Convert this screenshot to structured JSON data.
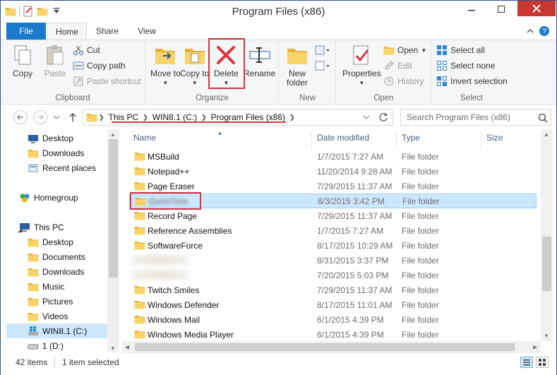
{
  "window": {
    "title": "Program Files (x86)"
  },
  "ribbon_tabs": {
    "file": "File",
    "home": "Home",
    "share": "Share",
    "view": "View"
  },
  "ribbon": {
    "clipboard": {
      "label": "Clipboard",
      "copy": "Copy",
      "paste": "Paste",
      "cut": "Cut",
      "copy_path": "Copy path",
      "paste_shortcut": "Paste shortcut"
    },
    "organize": {
      "label": "Organize",
      "move_to": "Move to",
      "copy_to": "Copy to",
      "delete": "Delete",
      "rename": "Rename"
    },
    "new": {
      "label": "New",
      "new_folder": "New folder"
    },
    "open": {
      "label": "Open",
      "properties": "Properties",
      "open": "Open",
      "edit": "Edit",
      "history": "History"
    },
    "select": {
      "label": "Select",
      "select_all": "Select all",
      "select_none": "Select none",
      "invert_selection": "Invert selection"
    }
  },
  "address": {
    "crumbs": [
      "This PC",
      "WIN8.1 (C:)",
      "Program Files (x86)"
    ],
    "search_placeholder": "Search Program Files (x86)"
  },
  "sidebar": {
    "items": [
      {
        "label": "Desktop"
      },
      {
        "label": "Downloads"
      },
      {
        "label": "Recent places"
      },
      {
        "label": "Homegroup"
      },
      {
        "label": "This PC"
      },
      {
        "label": "Desktop"
      },
      {
        "label": "Documents"
      },
      {
        "label": "Downloads"
      },
      {
        "label": "Music"
      },
      {
        "label": "Pictures"
      },
      {
        "label": "Videos"
      },
      {
        "label": "WIN8.1 (C:)"
      },
      {
        "label": "1 (D:)"
      }
    ]
  },
  "columns": {
    "name": "Name",
    "date": "Date modified",
    "type": "Type",
    "size": "Size"
  },
  "files": [
    {
      "name": "MSBuild",
      "date": "1/7/2015 7:27 AM",
      "type": "File folder"
    },
    {
      "name": "Notepad++",
      "date": "11/20/2014 9:28 AM",
      "type": "File folder"
    },
    {
      "name": "Page Eraser",
      "date": "7/29/2015 11:37 AM",
      "type": "File folder"
    },
    {
      "name": "QuickTime",
      "date": "8/3/2015 3:42 PM",
      "type": "File folder"
    },
    {
      "name": "Record Page",
      "date": "7/29/2015 11:37 AM",
      "type": "File folder"
    },
    {
      "name": "Reference Assemblies",
      "date": "1/7/2015 7:27 AM",
      "type": "File folder"
    },
    {
      "name": "SoftwareForce",
      "date": "8/17/2015 10:29 AM",
      "type": "File folder"
    },
    {
      "name": "",
      "date": "8/31/2015 3:37 PM",
      "type": "File folder"
    },
    {
      "name": "",
      "date": "7/20/2015 5:03 PM",
      "type": "File folder"
    },
    {
      "name": "Twitch Smiles",
      "date": "7/29/2015 11:37 AM",
      "type": "File folder"
    },
    {
      "name": "Windows Defender",
      "date": "8/17/2015 11:01 AM",
      "type": "File folder"
    },
    {
      "name": "Windows Mail",
      "date": "6/1/2015 4:39 PM",
      "type": "File folder"
    },
    {
      "name": "Windows Media Player",
      "date": "6/1/2015 4:39 PM",
      "type": "File folder"
    }
  ],
  "status": {
    "items_count": "42 items",
    "selected": "1 item selected"
  },
  "colors": {
    "accent": "#1979ca",
    "selection": "#cce8ff",
    "highlight_red": "#d9343b",
    "folder_yellow": "#f2c94c"
  }
}
